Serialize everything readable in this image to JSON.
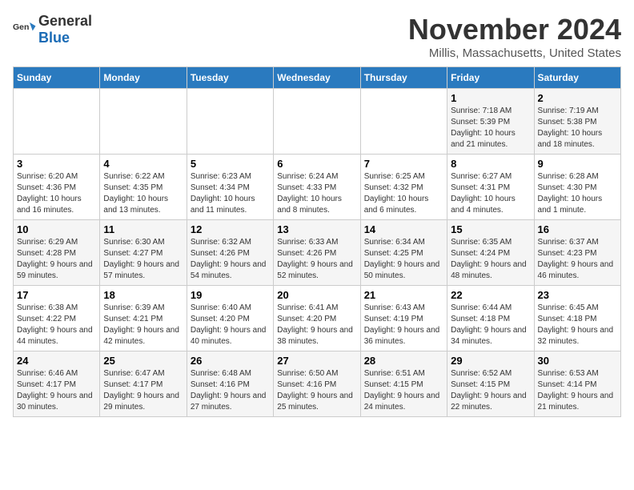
{
  "logo": {
    "general": "General",
    "blue": "Blue"
  },
  "title": "November 2024",
  "location": "Millis, Massachusetts, United States",
  "days_of_week": [
    "Sunday",
    "Monday",
    "Tuesday",
    "Wednesday",
    "Thursday",
    "Friday",
    "Saturday"
  ],
  "weeks": [
    [
      {
        "day": "",
        "info": ""
      },
      {
        "day": "",
        "info": ""
      },
      {
        "day": "",
        "info": ""
      },
      {
        "day": "",
        "info": ""
      },
      {
        "day": "",
        "info": ""
      },
      {
        "day": "1",
        "info": "Sunrise: 7:18 AM\nSunset: 5:39 PM\nDaylight: 10 hours and 21 minutes."
      },
      {
        "day": "2",
        "info": "Sunrise: 7:19 AM\nSunset: 5:38 PM\nDaylight: 10 hours and 18 minutes."
      }
    ],
    [
      {
        "day": "3",
        "info": "Sunrise: 6:20 AM\nSunset: 4:36 PM\nDaylight: 10 hours and 16 minutes."
      },
      {
        "day": "4",
        "info": "Sunrise: 6:22 AM\nSunset: 4:35 PM\nDaylight: 10 hours and 13 minutes."
      },
      {
        "day": "5",
        "info": "Sunrise: 6:23 AM\nSunset: 4:34 PM\nDaylight: 10 hours and 11 minutes."
      },
      {
        "day": "6",
        "info": "Sunrise: 6:24 AM\nSunset: 4:33 PM\nDaylight: 10 hours and 8 minutes."
      },
      {
        "day": "7",
        "info": "Sunrise: 6:25 AM\nSunset: 4:32 PM\nDaylight: 10 hours and 6 minutes."
      },
      {
        "day": "8",
        "info": "Sunrise: 6:27 AM\nSunset: 4:31 PM\nDaylight: 10 hours and 4 minutes."
      },
      {
        "day": "9",
        "info": "Sunrise: 6:28 AM\nSunset: 4:30 PM\nDaylight: 10 hours and 1 minute."
      }
    ],
    [
      {
        "day": "10",
        "info": "Sunrise: 6:29 AM\nSunset: 4:28 PM\nDaylight: 9 hours and 59 minutes."
      },
      {
        "day": "11",
        "info": "Sunrise: 6:30 AM\nSunset: 4:27 PM\nDaylight: 9 hours and 57 minutes."
      },
      {
        "day": "12",
        "info": "Sunrise: 6:32 AM\nSunset: 4:26 PM\nDaylight: 9 hours and 54 minutes."
      },
      {
        "day": "13",
        "info": "Sunrise: 6:33 AM\nSunset: 4:26 PM\nDaylight: 9 hours and 52 minutes."
      },
      {
        "day": "14",
        "info": "Sunrise: 6:34 AM\nSunset: 4:25 PM\nDaylight: 9 hours and 50 minutes."
      },
      {
        "day": "15",
        "info": "Sunrise: 6:35 AM\nSunset: 4:24 PM\nDaylight: 9 hours and 48 minutes."
      },
      {
        "day": "16",
        "info": "Sunrise: 6:37 AM\nSunset: 4:23 PM\nDaylight: 9 hours and 46 minutes."
      }
    ],
    [
      {
        "day": "17",
        "info": "Sunrise: 6:38 AM\nSunset: 4:22 PM\nDaylight: 9 hours and 44 minutes."
      },
      {
        "day": "18",
        "info": "Sunrise: 6:39 AM\nSunset: 4:21 PM\nDaylight: 9 hours and 42 minutes."
      },
      {
        "day": "19",
        "info": "Sunrise: 6:40 AM\nSunset: 4:20 PM\nDaylight: 9 hours and 40 minutes."
      },
      {
        "day": "20",
        "info": "Sunrise: 6:41 AM\nSunset: 4:20 PM\nDaylight: 9 hours and 38 minutes."
      },
      {
        "day": "21",
        "info": "Sunrise: 6:43 AM\nSunset: 4:19 PM\nDaylight: 9 hours and 36 minutes."
      },
      {
        "day": "22",
        "info": "Sunrise: 6:44 AM\nSunset: 4:18 PM\nDaylight: 9 hours and 34 minutes."
      },
      {
        "day": "23",
        "info": "Sunrise: 6:45 AM\nSunset: 4:18 PM\nDaylight: 9 hours and 32 minutes."
      }
    ],
    [
      {
        "day": "24",
        "info": "Sunrise: 6:46 AM\nSunset: 4:17 PM\nDaylight: 9 hours and 30 minutes."
      },
      {
        "day": "25",
        "info": "Sunrise: 6:47 AM\nSunset: 4:17 PM\nDaylight: 9 hours and 29 minutes."
      },
      {
        "day": "26",
        "info": "Sunrise: 6:48 AM\nSunset: 4:16 PM\nDaylight: 9 hours and 27 minutes."
      },
      {
        "day": "27",
        "info": "Sunrise: 6:50 AM\nSunset: 4:16 PM\nDaylight: 9 hours and 25 minutes."
      },
      {
        "day": "28",
        "info": "Sunrise: 6:51 AM\nSunset: 4:15 PM\nDaylight: 9 hours and 24 minutes."
      },
      {
        "day": "29",
        "info": "Sunrise: 6:52 AM\nSunset: 4:15 PM\nDaylight: 9 hours and 22 minutes."
      },
      {
        "day": "30",
        "info": "Sunrise: 6:53 AM\nSunset: 4:14 PM\nDaylight: 9 hours and 21 minutes."
      }
    ]
  ]
}
